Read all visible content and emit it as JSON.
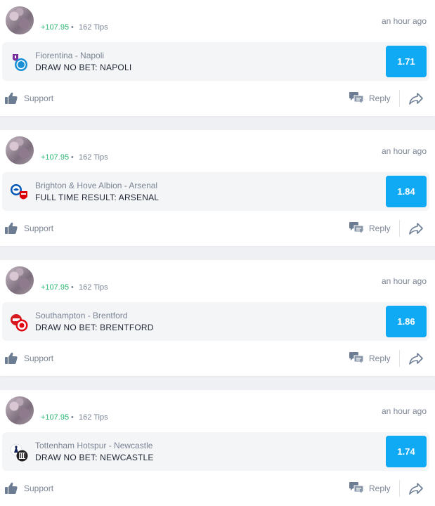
{
  "feed": {
    "posts": [
      {
        "profit": "+107.95",
        "separator": "•",
        "tips": "162 Tips",
        "time": "an hour ago",
        "match": "Fiorentina - Napoli",
        "market": "DRAW NO BET: NAPOLI",
        "odds": "1.71",
        "logo_icon": "fiorentina-napoli-crest-icon",
        "support_label": "Support",
        "reply_label": "Reply"
      },
      {
        "profit": "+107.95",
        "separator": "•",
        "tips": "162 Tips",
        "time": "an hour ago",
        "match": "Brighton & Hove Albion - Arsenal",
        "market": "FULL TIME RESULT: ARSENAL",
        "odds": "1.84",
        "logo_icon": "brighton-arsenal-crest-icon",
        "support_label": "Support",
        "reply_label": "Reply"
      },
      {
        "profit": "+107.95",
        "separator": "•",
        "tips": "162 Tips",
        "time": "an hour ago",
        "match": "Southampton - Brentford",
        "market": "DRAW NO BET: BRENTFORD",
        "odds": "1.86",
        "logo_icon": "southampton-brentford-crest-icon",
        "support_label": "Support",
        "reply_label": "Reply"
      },
      {
        "profit": "+107.95",
        "separator": "•",
        "tips": "162 Tips",
        "time": "an hour ago",
        "match": "Tottenham Hotspur - Newcastle",
        "market": "DRAW NO BET: NEWCASTLE",
        "odds": "1.74",
        "logo_icon": "tottenham-newcastle-crest-icon",
        "support_label": "Support",
        "reply_label": "Reply"
      }
    ]
  },
  "colors": {
    "profit": "#2bb673",
    "odds_button": "#0fa9f4",
    "muted_text": "#7b8494",
    "icon": "#6b7c93"
  }
}
